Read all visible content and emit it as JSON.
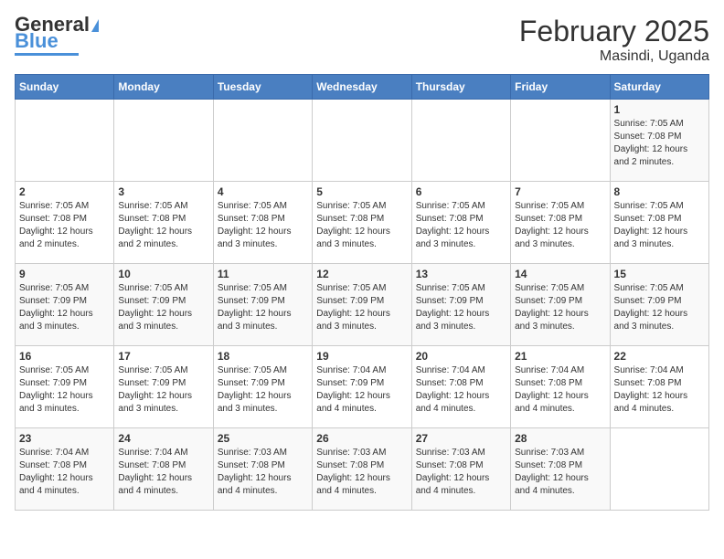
{
  "logo": {
    "line1": "General",
    "line2": "Blue"
  },
  "title": "February 2025",
  "subtitle": "Masindi, Uganda",
  "days_of_week": [
    "Sunday",
    "Monday",
    "Tuesday",
    "Wednesday",
    "Thursday",
    "Friday",
    "Saturday"
  ],
  "weeks": [
    [
      {
        "day": "",
        "info": ""
      },
      {
        "day": "",
        "info": ""
      },
      {
        "day": "",
        "info": ""
      },
      {
        "day": "",
        "info": ""
      },
      {
        "day": "",
        "info": ""
      },
      {
        "day": "",
        "info": ""
      },
      {
        "day": "1",
        "info": "Sunrise: 7:05 AM\nSunset: 7:08 PM\nDaylight: 12 hours\nand 2 minutes."
      }
    ],
    [
      {
        "day": "2",
        "info": "Sunrise: 7:05 AM\nSunset: 7:08 PM\nDaylight: 12 hours\nand 2 minutes."
      },
      {
        "day": "3",
        "info": "Sunrise: 7:05 AM\nSunset: 7:08 PM\nDaylight: 12 hours\nand 2 minutes."
      },
      {
        "day": "4",
        "info": "Sunrise: 7:05 AM\nSunset: 7:08 PM\nDaylight: 12 hours\nand 3 minutes."
      },
      {
        "day": "5",
        "info": "Sunrise: 7:05 AM\nSunset: 7:08 PM\nDaylight: 12 hours\nand 3 minutes."
      },
      {
        "day": "6",
        "info": "Sunrise: 7:05 AM\nSunset: 7:08 PM\nDaylight: 12 hours\nand 3 minutes."
      },
      {
        "day": "7",
        "info": "Sunrise: 7:05 AM\nSunset: 7:08 PM\nDaylight: 12 hours\nand 3 minutes."
      },
      {
        "day": "8",
        "info": "Sunrise: 7:05 AM\nSunset: 7:08 PM\nDaylight: 12 hours\nand 3 minutes."
      }
    ],
    [
      {
        "day": "9",
        "info": "Sunrise: 7:05 AM\nSunset: 7:09 PM\nDaylight: 12 hours\nand 3 minutes."
      },
      {
        "day": "10",
        "info": "Sunrise: 7:05 AM\nSunset: 7:09 PM\nDaylight: 12 hours\nand 3 minutes."
      },
      {
        "day": "11",
        "info": "Sunrise: 7:05 AM\nSunset: 7:09 PM\nDaylight: 12 hours\nand 3 minutes."
      },
      {
        "day": "12",
        "info": "Sunrise: 7:05 AM\nSunset: 7:09 PM\nDaylight: 12 hours\nand 3 minutes."
      },
      {
        "day": "13",
        "info": "Sunrise: 7:05 AM\nSunset: 7:09 PM\nDaylight: 12 hours\nand 3 minutes."
      },
      {
        "day": "14",
        "info": "Sunrise: 7:05 AM\nSunset: 7:09 PM\nDaylight: 12 hours\nand 3 minutes."
      },
      {
        "day": "15",
        "info": "Sunrise: 7:05 AM\nSunset: 7:09 PM\nDaylight: 12 hours\nand 3 minutes."
      }
    ],
    [
      {
        "day": "16",
        "info": "Sunrise: 7:05 AM\nSunset: 7:09 PM\nDaylight: 12 hours\nand 3 minutes."
      },
      {
        "day": "17",
        "info": "Sunrise: 7:05 AM\nSunset: 7:09 PM\nDaylight: 12 hours\nand 3 minutes."
      },
      {
        "day": "18",
        "info": "Sunrise: 7:05 AM\nSunset: 7:09 PM\nDaylight: 12 hours\nand 3 minutes."
      },
      {
        "day": "19",
        "info": "Sunrise: 7:04 AM\nSunset: 7:09 PM\nDaylight: 12 hours\nand 4 minutes."
      },
      {
        "day": "20",
        "info": "Sunrise: 7:04 AM\nSunset: 7:08 PM\nDaylight: 12 hours\nand 4 minutes."
      },
      {
        "day": "21",
        "info": "Sunrise: 7:04 AM\nSunset: 7:08 PM\nDaylight: 12 hours\nand 4 minutes."
      },
      {
        "day": "22",
        "info": "Sunrise: 7:04 AM\nSunset: 7:08 PM\nDaylight: 12 hours\nand 4 minutes."
      }
    ],
    [
      {
        "day": "23",
        "info": "Sunrise: 7:04 AM\nSunset: 7:08 PM\nDaylight: 12 hours\nand 4 minutes."
      },
      {
        "day": "24",
        "info": "Sunrise: 7:04 AM\nSunset: 7:08 PM\nDaylight: 12 hours\nand 4 minutes."
      },
      {
        "day": "25",
        "info": "Sunrise: 7:03 AM\nSunset: 7:08 PM\nDaylight: 12 hours\nand 4 minutes."
      },
      {
        "day": "26",
        "info": "Sunrise: 7:03 AM\nSunset: 7:08 PM\nDaylight: 12 hours\nand 4 minutes."
      },
      {
        "day": "27",
        "info": "Sunrise: 7:03 AM\nSunset: 7:08 PM\nDaylight: 12 hours\nand 4 minutes."
      },
      {
        "day": "28",
        "info": "Sunrise: 7:03 AM\nSunset: 7:08 PM\nDaylight: 12 hours\nand 4 minutes."
      },
      {
        "day": "",
        "info": ""
      }
    ]
  ]
}
